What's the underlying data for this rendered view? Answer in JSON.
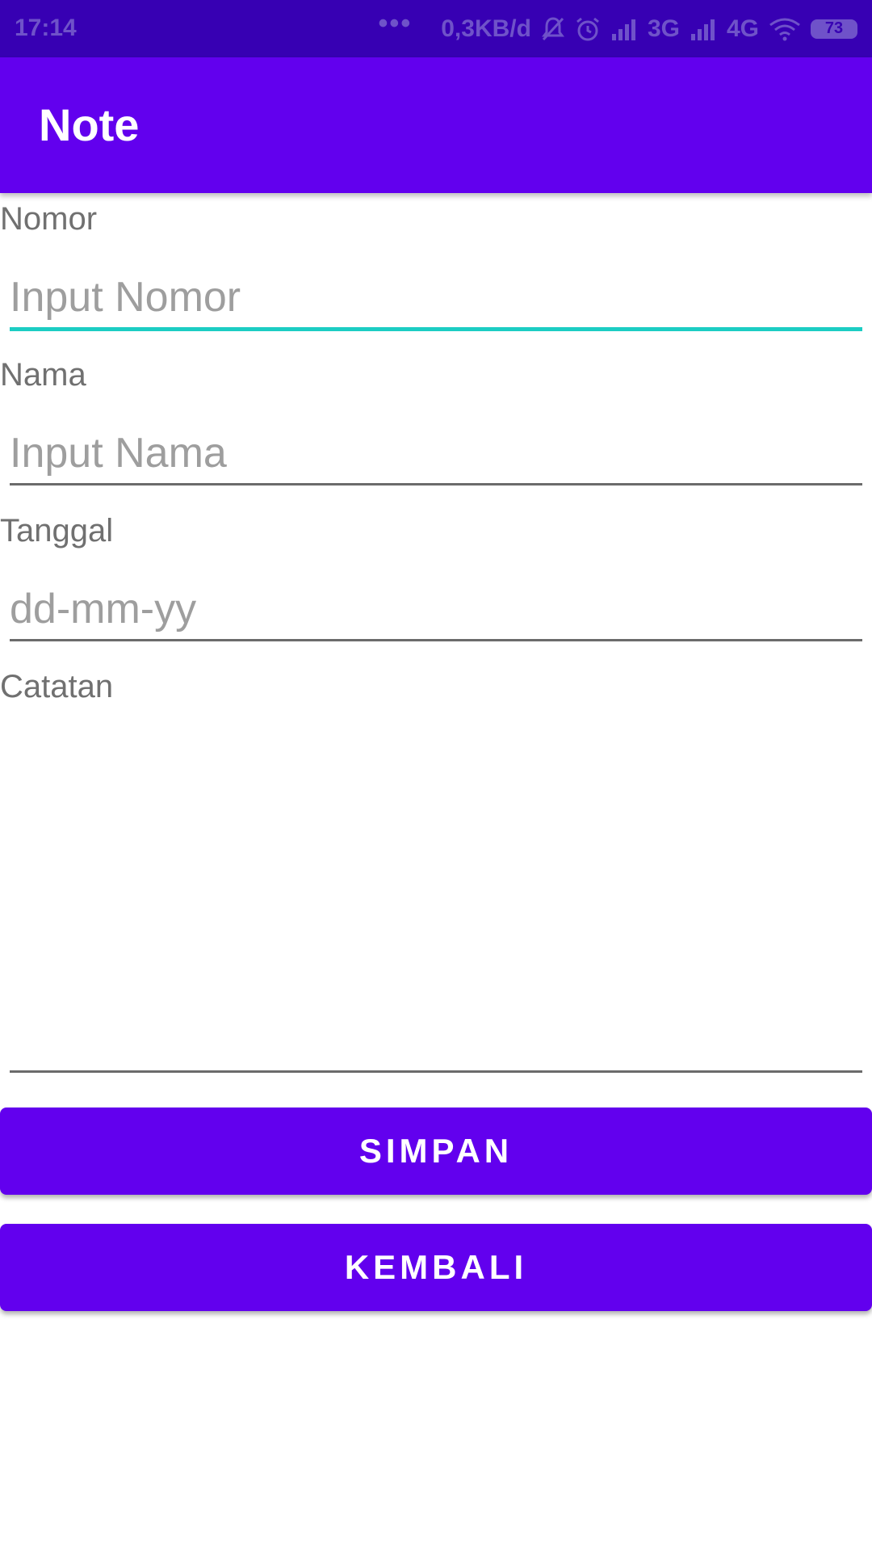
{
  "status_bar": {
    "time": "17:14",
    "more": "•••",
    "network_speed": "0,3KB/d",
    "signal_1": "3G",
    "signal_2": "4G",
    "battery": "73"
  },
  "app_bar": {
    "title": "Note"
  },
  "form": {
    "nomor": {
      "label": "Nomor",
      "placeholder": "Input Nomor",
      "value": ""
    },
    "nama": {
      "label": "Nama",
      "placeholder": "Input Nama",
      "value": ""
    },
    "tanggal": {
      "label": "Tanggal",
      "placeholder": "dd-mm-yy",
      "value": ""
    },
    "catatan": {
      "label": "Catatan",
      "value": ""
    }
  },
  "buttons": {
    "simpan": "SIMPAN",
    "kembali": "KEMBALI"
  },
  "colors": {
    "status_bar": "#3700b3",
    "primary": "#6200ee",
    "focus_underline": "#1ccdc3"
  },
  "icons": [
    "mute-bell-icon",
    "alarm-icon",
    "signal-icon",
    "wifi-icon",
    "battery-icon"
  ]
}
